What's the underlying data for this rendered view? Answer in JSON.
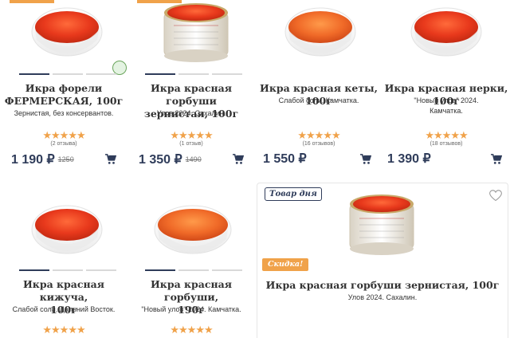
{
  "products": [
    {
      "title": "Икра форели ФЕРМЕРСКАЯ, 100г",
      "title_line1": "Икра форели",
      "title_line2": "ФЕРМЕРСКАЯ, 100г",
      "description": "Зернистая, без консервантов.",
      "stars": "★★★★★",
      "reviews": "(2 отзыва)",
      "price": "1 190 ₽",
      "old_price": "1250",
      "rating": 5
    },
    {
      "title": "Икра красная горбуши зернистая, 100г",
      "title_line1": "Икра красная горбуши",
      "title_line2": "зернистая, 100г",
      "description": "Улов 2024. Сахалин.",
      "stars": "★★★★★",
      "reviews": "(1 отзыв)",
      "price": "1 350 ₽",
      "old_price": "1490",
      "rating": 5
    },
    {
      "title": "Икра красная кеты, 100г",
      "title_line1": "Икра красная кеты, 100г",
      "description": "Слабой соли. Камчатка.",
      "stars": "★★★★★",
      "reviews": "(16 отзывов)",
      "price": "1 550 ₽",
      "rating": 5
    },
    {
      "title": "Икра красная нерки, 100г",
      "title_line1": "Икра красная нерки, 100г",
      "description_line1": "\"Новый улов\" 2024.",
      "description_line2": "Камчатка.",
      "stars": "★★★★★",
      "reviews": "(18 отзывов)",
      "price": "1 390 ₽",
      "rating": 5
    },
    {
      "title": "Икра красная кижуча, 100г",
      "title_line1": "Икра красная кижуча,",
      "title_line2": "100г",
      "description": "Слабой соли. Дальний Восток.",
      "stars": "★★★★★",
      "rating": 5
    },
    {
      "title": "Икра красная горбуши, 190г",
      "title_line1": "Икра красная горбуши,",
      "title_line2": "190г",
      "description": "\"Новый улов\" 2024. Камчатка.",
      "stars": "★★★★★",
      "rating": 5
    }
  ],
  "deal_of_day": {
    "tag": "Товар дня",
    "sale_tag": "Скидка!",
    "title": "Икра красная горбуши зернистая, 100г",
    "description": "Улов 2024. Сахалин."
  },
  "colors": {
    "accent": "#f0a24a",
    "price": "#2f3c5a",
    "caviar": "#e8391c"
  },
  "icons": [
    "cart-icon",
    "heart-icon",
    "eco-badge-icon",
    "star-icon"
  ]
}
